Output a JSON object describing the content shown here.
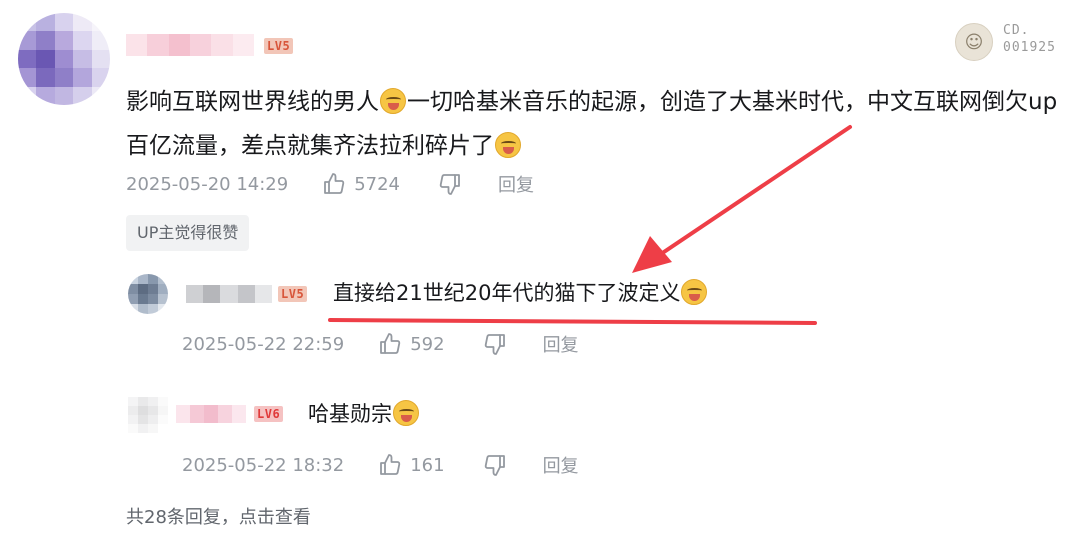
{
  "comment": {
    "level": "LV5",
    "text_part1": "影响互联网世界线的男人",
    "text_part2": "一切哈基米音乐的起源，创造了大基米时代，中文互联网倒欠up百亿流量，差点就集齐法拉利碎片了",
    "date": "2025-05-20 14:29",
    "likes": "5724",
    "reply_label": "回复",
    "up_tag": "UP主觉得很赞"
  },
  "decoration": {
    "line1": "CD.",
    "line2": "001925"
  },
  "replies": [
    {
      "level": "LV5",
      "text": "直接给21世纪20年代的猫下了波定义",
      "date": "2025-05-22 22:59",
      "likes": "592",
      "reply_label": "回复"
    },
    {
      "level": "LV6",
      "text": "哈基勋宗",
      "date": "2025-05-22 18:32",
      "likes": "161",
      "reply_label": "回复"
    }
  ],
  "view_all": "共28条回复，点击查看",
  "annotation": {
    "color": "#ee3e47"
  },
  "icons": {
    "like": "thumbs-up-icon",
    "dislike": "thumbs-down-icon",
    "emoji": "laugh-cry-emoji-icon"
  }
}
